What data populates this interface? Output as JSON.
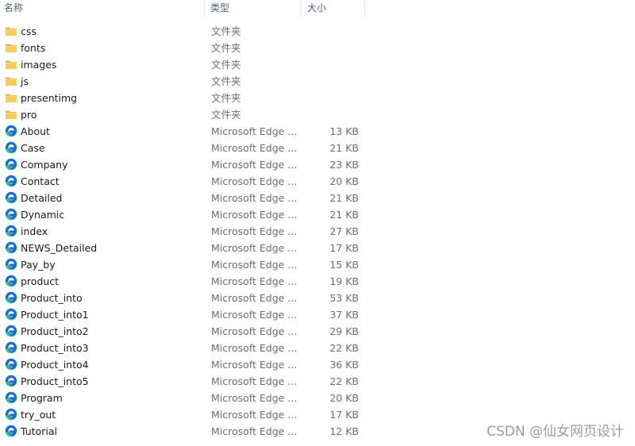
{
  "columns": {
    "name": "名称",
    "type": "类型",
    "size": "大小"
  },
  "icons": {
    "folder": "folder-icon",
    "edge": "edge-html-file-icon"
  },
  "colors": {
    "folder": "#e8b84a",
    "edge_blue": "#1f6fc9",
    "edge_green": "#32c48d"
  },
  "rows": [
    {
      "name": "css",
      "kind": "folder",
      "type": "文件夹",
      "size": ""
    },
    {
      "name": "fonts",
      "kind": "folder",
      "type": "文件夹",
      "size": ""
    },
    {
      "name": "images",
      "kind": "folder",
      "type": "文件夹",
      "size": ""
    },
    {
      "name": "js",
      "kind": "folder",
      "type": "文件夹",
      "size": ""
    },
    {
      "name": "presentimg",
      "kind": "folder",
      "type": "文件夹",
      "size": ""
    },
    {
      "name": "pro",
      "kind": "folder",
      "type": "文件夹",
      "size": ""
    },
    {
      "name": "About",
      "kind": "edge",
      "type": "Microsoft Edge ...",
      "size": "13 KB"
    },
    {
      "name": "Case",
      "kind": "edge",
      "type": "Microsoft Edge ...",
      "size": "21 KB"
    },
    {
      "name": "Company",
      "kind": "edge",
      "type": "Microsoft Edge ...",
      "size": "23 KB"
    },
    {
      "name": "Contact",
      "kind": "edge",
      "type": "Microsoft Edge ...",
      "size": "20 KB"
    },
    {
      "name": "Detailed",
      "kind": "edge",
      "type": "Microsoft Edge ...",
      "size": "21 KB"
    },
    {
      "name": "Dynamic",
      "kind": "edge",
      "type": "Microsoft Edge ...",
      "size": "21 KB"
    },
    {
      "name": "index",
      "kind": "edge",
      "type": "Microsoft Edge ...",
      "size": "27 KB"
    },
    {
      "name": "NEWS_Detailed",
      "kind": "edge",
      "type": "Microsoft Edge ...",
      "size": "17 KB"
    },
    {
      "name": "Pay_by",
      "kind": "edge",
      "type": "Microsoft Edge ...",
      "size": "15 KB"
    },
    {
      "name": "product",
      "kind": "edge",
      "type": "Microsoft Edge ...",
      "size": "19 KB"
    },
    {
      "name": "Product_into",
      "kind": "edge",
      "type": "Microsoft Edge ...",
      "size": "53 KB"
    },
    {
      "name": "Product_into1",
      "kind": "edge",
      "type": "Microsoft Edge ...",
      "size": "37 KB"
    },
    {
      "name": "Product_into2",
      "kind": "edge",
      "type": "Microsoft Edge ...",
      "size": "29 KB"
    },
    {
      "name": "Product_into3",
      "kind": "edge",
      "type": "Microsoft Edge ...",
      "size": "22 KB"
    },
    {
      "name": "Product_into4",
      "kind": "edge",
      "type": "Microsoft Edge ...",
      "size": "36 KB"
    },
    {
      "name": "Product_into5",
      "kind": "edge",
      "type": "Microsoft Edge ...",
      "size": "22 KB"
    },
    {
      "name": "Program",
      "kind": "edge",
      "type": "Microsoft Edge ...",
      "size": "20 KB"
    },
    {
      "name": "try_out",
      "kind": "edge",
      "type": "Microsoft Edge ...",
      "size": "17 KB"
    },
    {
      "name": "Tutorial",
      "kind": "edge",
      "type": "Microsoft Edge ...",
      "size": "12 KB"
    }
  ],
  "watermark": "CSDN @仙女网页设计"
}
